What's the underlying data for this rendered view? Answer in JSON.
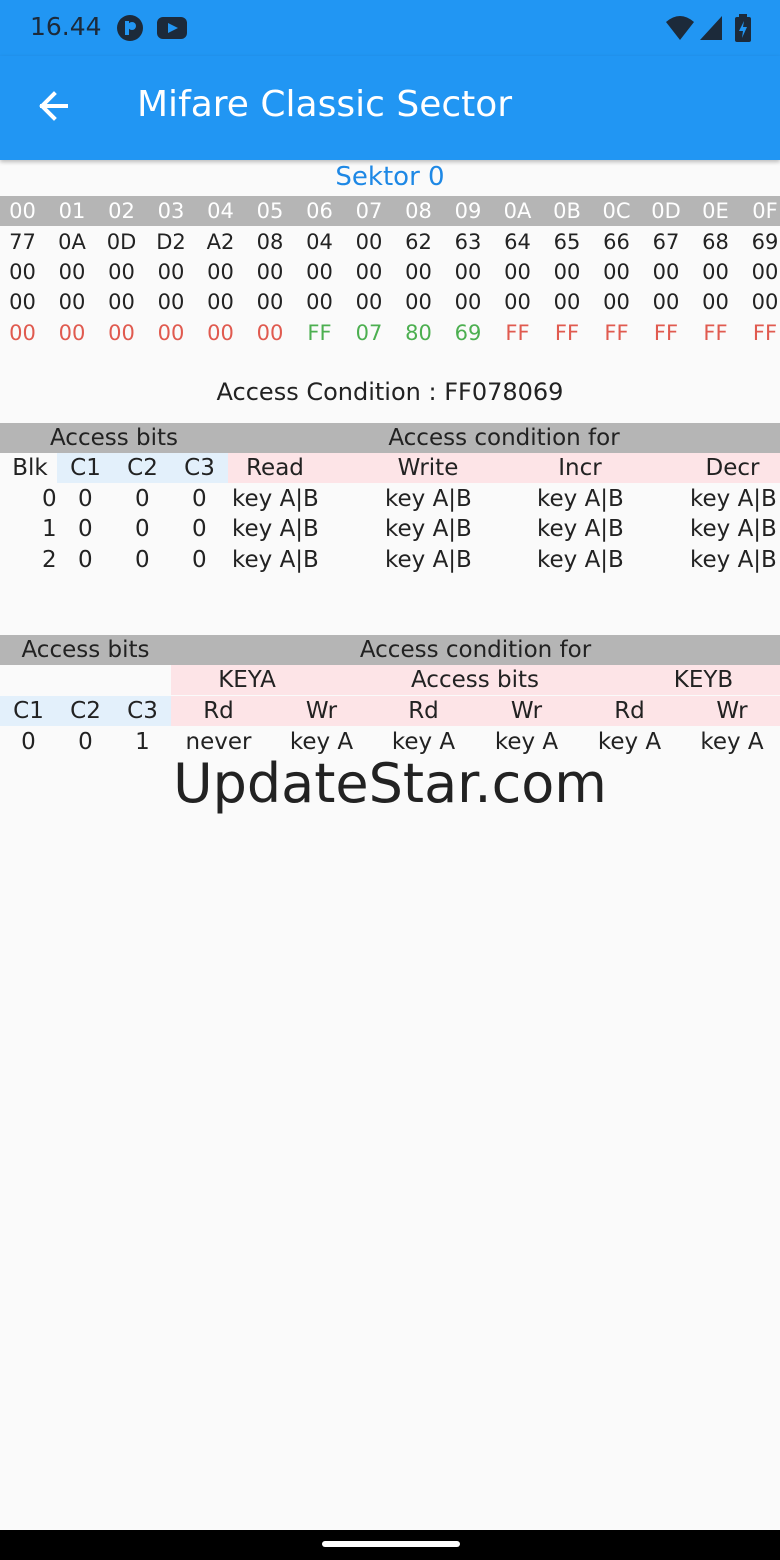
{
  "status_bar": {
    "time": "16.44"
  },
  "app_bar": {
    "title": "Mifare Classic Sector"
  },
  "sector_title": "Sektor 0",
  "hex_header": [
    "00",
    "01",
    "02",
    "03",
    "04",
    "05",
    "06",
    "07",
    "08",
    "09",
    "0A",
    "0B",
    "0C",
    "0D",
    "0E",
    "0F"
  ],
  "hex_rows": [
    [
      "77",
      "0A",
      "0D",
      "D2",
      "A2",
      "08",
      "04",
      "00",
      "62",
      "63",
      "64",
      "65",
      "66",
      "67",
      "68",
      "69"
    ],
    [
      "00",
      "00",
      "00",
      "00",
      "00",
      "00",
      "00",
      "00",
      "00",
      "00",
      "00",
      "00",
      "00",
      "00",
      "00",
      "00"
    ],
    [
      "00",
      "00",
      "00",
      "00",
      "00",
      "00",
      "00",
      "00",
      "00",
      "00",
      "00",
      "00",
      "00",
      "00",
      "00",
      "00"
    ],
    [
      "00",
      "00",
      "00",
      "00",
      "00",
      "00",
      "FF",
      "07",
      "80",
      "69",
      "FF",
      "FF",
      "FF",
      "FF",
      "FF",
      "FF"
    ]
  ],
  "colors": {
    "key_a": "#e05a4f",
    "access_bits": "#4caf50",
    "key_b": "#e05a4f",
    "accent": "#2196f3"
  },
  "access_condition": "Access Condition : FF078069",
  "data_blocks_table": {
    "group_left": "Access bits",
    "group_right": "Access condition for",
    "columns": [
      "Blk",
      "C1",
      "C2",
      "C3",
      "Read",
      "Write",
      "Incr",
      "Decr"
    ],
    "rows": [
      [
        "0",
        "0",
        "0",
        "0",
        "key A|B",
        "key A|B",
        "key A|B",
        "key A|B"
      ],
      [
        "1",
        "0",
        "0",
        "0",
        "key A|B",
        "key A|B",
        "key A|B",
        "key A|B"
      ],
      [
        "2",
        "0",
        "0",
        "0",
        "key A|B",
        "key A|B",
        "key A|B",
        "key A|B"
      ]
    ]
  },
  "trailer_table": {
    "group_left": "Access bits",
    "group_right": "Access condition for",
    "subgroups": [
      "KEYA",
      "Access bits",
      "KEYB"
    ],
    "columns": [
      "C1",
      "C2",
      "C3",
      "Rd",
      "Wr",
      "Rd",
      "Wr",
      "Rd",
      "Wr"
    ],
    "row": [
      "0",
      "0",
      "1",
      "never",
      "key A",
      "key A",
      "key A",
      "key A",
      "key A"
    ]
  },
  "watermark": "UpdateStar.com"
}
